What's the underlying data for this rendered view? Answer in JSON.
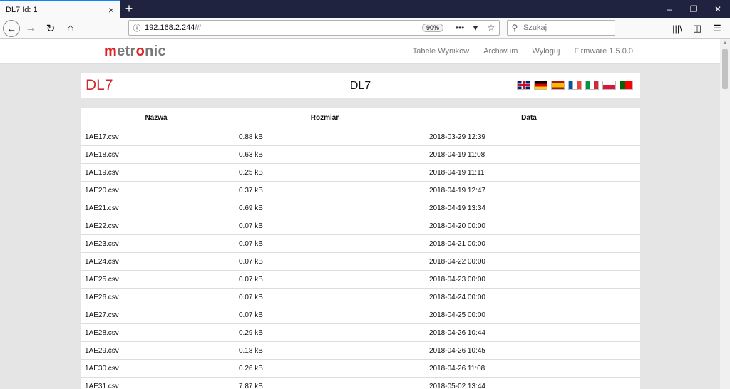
{
  "browser": {
    "tab_title": "DL7 Id: 1",
    "tab_close": "×",
    "new_tab": "+",
    "url_host": "192.168.2.244",
    "url_path": "/#",
    "zoom": "90%",
    "search_placeholder": "Szukaj"
  },
  "site": {
    "logo": {
      "part1": "m",
      "part2": "etr",
      "part3": "o",
      "part4": "nic"
    },
    "nav": [
      "Tabele Wyników",
      "Archiwum",
      "Wyloguj",
      "Firmware 1.5.0.0"
    ]
  },
  "title": {
    "left": "DL7",
    "center": "DL7"
  },
  "flags": [
    {
      "name": "flag-uk",
      "colors": [
        "#012169",
        "#ffffff",
        "#c8102e"
      ]
    },
    {
      "name": "flag-de",
      "colors": [
        "#000000",
        "#dd0000",
        "#ffce00"
      ]
    },
    {
      "name": "flag-es",
      "colors": [
        "#aa151b",
        "#f1bf00",
        "#aa151b"
      ]
    },
    {
      "name": "flag-fr",
      "colors": [
        "#0055a4",
        "#ffffff",
        "#ef4135"
      ]
    },
    {
      "name": "flag-it",
      "colors": [
        "#009246",
        "#ffffff",
        "#ce2b37"
      ]
    },
    {
      "name": "flag-pl",
      "colors": [
        "#ffffff",
        "#dc143c"
      ]
    },
    {
      "name": "flag-pt",
      "colors": [
        "#006600",
        "#ff0000"
      ]
    }
  ],
  "table": {
    "headers": [
      "Nazwa",
      "Rozmiar",
      "Data"
    ],
    "rows": [
      [
        "1AE17.csv",
        "0.88 kB",
        "2018-03-29 12:39"
      ],
      [
        "1AE18.csv",
        "0.63 kB",
        "2018-04-19 11:08"
      ],
      [
        "1AE19.csv",
        "0.25 kB",
        "2018-04-19 11:11"
      ],
      [
        "1AE20.csv",
        "0.37 kB",
        "2018-04-19 12:47"
      ],
      [
        "1AE21.csv",
        "0.69 kB",
        "2018-04-19 13:34"
      ],
      [
        "1AE22.csv",
        "0.07 kB",
        "2018-04-20 00:00"
      ],
      [
        "1AE23.csv",
        "0.07 kB",
        "2018-04-21 00:00"
      ],
      [
        "1AE24.csv",
        "0.07 kB",
        "2018-04-22 00:00"
      ],
      [
        "1AE25.csv",
        "0.07 kB",
        "2018-04-23 00:00"
      ],
      [
        "1AE26.csv",
        "0.07 kB",
        "2018-04-24 00:00"
      ],
      [
        "1AE27.csv",
        "0.07 kB",
        "2018-04-25 00:00"
      ],
      [
        "1AE28.csv",
        "0.29 kB",
        "2018-04-26 10:44"
      ],
      [
        "1AE29.csv",
        "0.18 kB",
        "2018-04-26 10:45"
      ],
      [
        "1AE30.csv",
        "0.26 kB",
        "2018-04-26 11:08"
      ],
      [
        "1AE31.csv",
        "7.87 kB",
        "2018-05-02 13:44"
      ]
    ]
  }
}
